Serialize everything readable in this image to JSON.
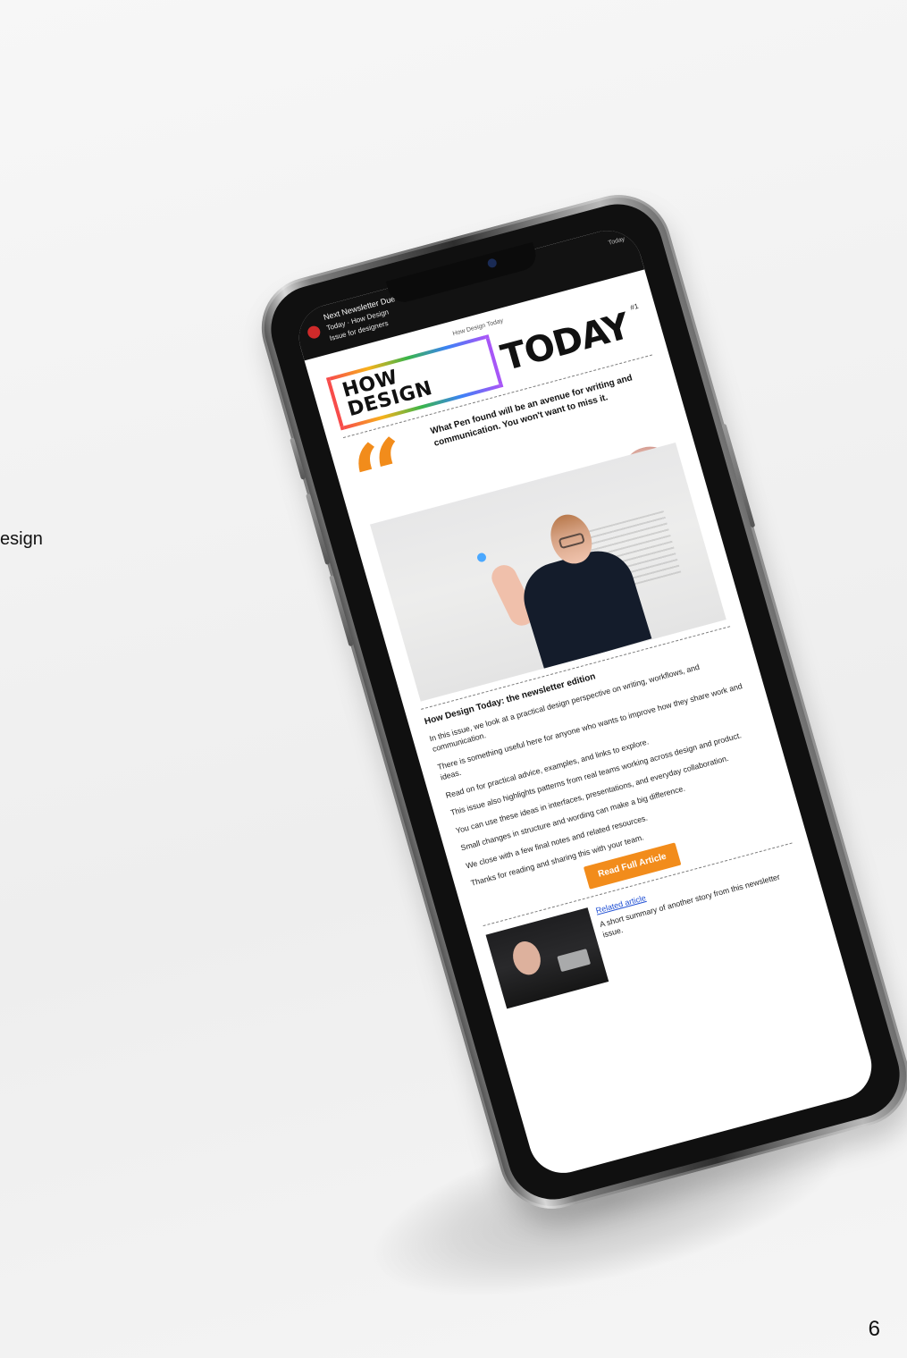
{
  "slide": {
    "cut_label": "esign",
    "page_number": "6"
  },
  "status_bar": {
    "line1": "Next Newsletter Due",
    "line2": "Today · How Design",
    "line3": "Issue for designers",
    "right_text": "Today"
  },
  "email": {
    "tagline": "How Design Today",
    "logo": {
      "left": "HOW DESIGN",
      "right": "TODAY",
      "small": "#1"
    },
    "quote": "What Pen found will be an avenue for writing and communication. You won't want to miss it.",
    "headline": "How Design Today: the newsletter edition",
    "paragraphs": [
      "In this issue, we look at a practical design perspective on writing, workflows, and communication.",
      "There is something useful here for anyone who wants to improve how they share work and ideas.",
      "Read on for practical advice, examples, and links to explore.",
      "This issue also highlights patterns from real teams working across design and product.",
      "You can use these ideas in interfaces, presentations, and everyday collaboration.",
      "Small changes in structure and wording can make a big difference.",
      "We close with a few final notes and related resources.",
      "Thanks for reading and sharing this with your team."
    ],
    "cta_label": "Read Full Article",
    "card": {
      "title": "Related article",
      "text": "A short summary of another story from this newsletter issue."
    }
  }
}
